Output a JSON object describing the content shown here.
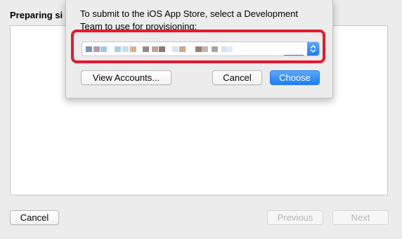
{
  "window": {
    "title": "Preparing si",
    "buttons": {
      "cancel": "Cancel",
      "previous": "Previous",
      "next": "Next"
    }
  },
  "sheet": {
    "message": "To submit to the iOS App Store, select a Development Team to use for provisioning:",
    "team_popup": {
      "selected_value": "(redacted team name)",
      "redacted": true
    },
    "buttons": {
      "view_accounts": "View Accounts...",
      "cancel": "Cancel",
      "choose": "Choose"
    }
  },
  "colors": {
    "highlight_border": "#e8182e",
    "primary_button": "#1c7ef5",
    "window_background": "#ececec"
  }
}
